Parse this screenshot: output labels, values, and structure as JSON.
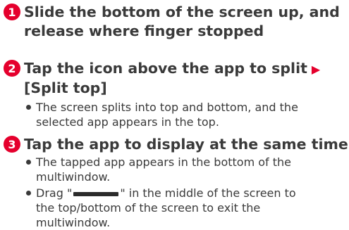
{
  "steps": [
    {
      "number": "1",
      "line1": "Slide the bottom of the screen up, and",
      "line2": "release where finger stopped"
    },
    {
      "number": "2",
      "line1": "Tap the icon above the app to split",
      "arrow": "▶",
      "line2": "[Split top]",
      "bullets": [
        {
          "line1": "The screen splits into top and bottom, and the",
          "line2": "selected app appears in the top."
        }
      ]
    },
    {
      "number": "3",
      "line1": "Tap the app to display at the same time",
      "bullets": [
        {
          "line1": "The tapped app appears in the bottom of the",
          "line2": "multiwindow."
        },
        {
          "line1_prefix": "Drag \"",
          "line1_suffix": "\" in the middle of the screen to",
          "line2": "the top/bottom of the screen to exit the",
          "line3": "multiwindow."
        }
      ]
    }
  ]
}
